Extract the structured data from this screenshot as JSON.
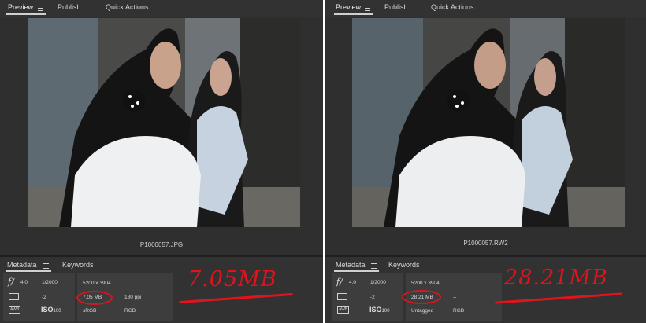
{
  "left": {
    "tabs": [
      "Preview",
      "Publish",
      "Quick Actions"
    ],
    "filename": "P1000057.JPG",
    "meta_tabs": [
      "Metadata",
      "Keywords"
    ],
    "aperture_symbol": "f/",
    "aperture": "4.0",
    "shutter": "1/2000",
    "exposure": "-2",
    "iso_label": "ISO",
    "iso_value": "100",
    "awb": "AWB",
    "dimensions": "5200 x 3904",
    "file_size": "7.05 MB",
    "resolution": "180 ppi",
    "color_profile": "sRGB",
    "color_mode": "RGB",
    "annotation": "7.05MB"
  },
  "right": {
    "tabs": [
      "Preview",
      "Publish",
      "Quick Actions"
    ],
    "filename": "P1000057.RW2",
    "meta_tabs": [
      "Metadata",
      "Keywords"
    ],
    "aperture_symbol": "f/",
    "aperture": "4.0",
    "shutter": "1/2000",
    "exposure": "-2",
    "iso_label": "ISO",
    "iso_value": "100",
    "awb": "AWB",
    "dimensions": "5200 x 3904",
    "file_size": "28.21 MB",
    "resolution": "--",
    "color_profile": "Untagged",
    "color_mode": "RGB",
    "annotation": "28.21MB"
  },
  "colors": {
    "panel_bg": "#323232",
    "annotation_red": "#e0141c"
  }
}
